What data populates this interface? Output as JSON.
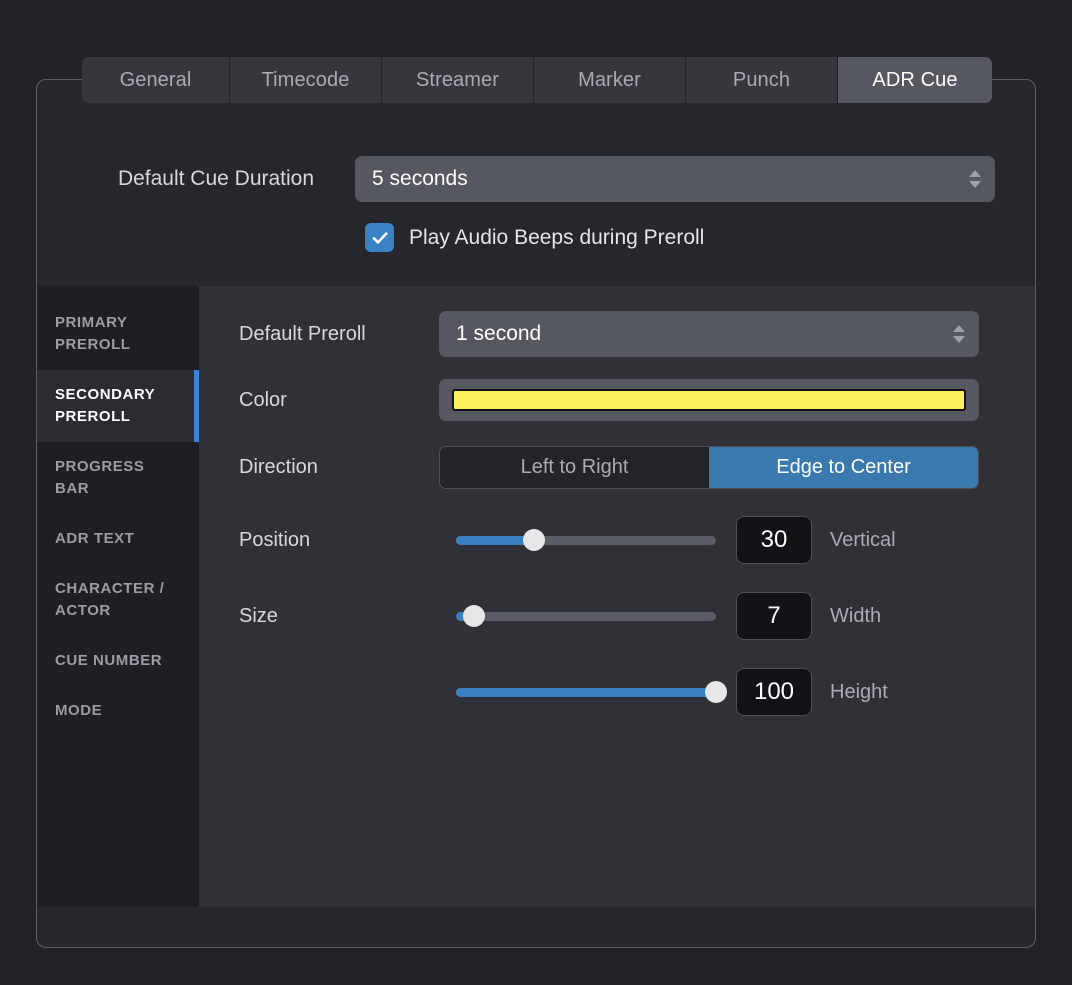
{
  "tabs": [
    {
      "label": "General",
      "width": 148,
      "active": false
    },
    {
      "label": "Timecode",
      "width": 152,
      "active": false
    },
    {
      "label": "Streamer",
      "width": 152,
      "active": false
    },
    {
      "label": "Marker",
      "width": 152,
      "active": false
    },
    {
      "label": "Punch",
      "width": 152,
      "active": false
    },
    {
      "label": "ADR Cue",
      "width": 154,
      "active": true
    }
  ],
  "top": {
    "duration_label": "Default Cue Duration",
    "duration_value": "5 seconds",
    "beeps_checkbox": {
      "label": "Play Audio Beeps during Preroll",
      "checked": true,
      "icon": "checkmark-icon"
    }
  },
  "sidebar": {
    "items": [
      {
        "label": "PRIMARY PREROLL",
        "active": false
      },
      {
        "label": "SECONDARY PREROLL",
        "active": true
      },
      {
        "label": "PROGRESS BAR",
        "active": false
      },
      {
        "label": "ADR TEXT",
        "active": false
      },
      {
        "label": "CHARACTER / ACTOR",
        "active": false
      },
      {
        "label": "CUE NUMBER",
        "active": false
      },
      {
        "label": "MODE",
        "active": false
      }
    ]
  },
  "content": {
    "preroll": {
      "label": "Default Preroll",
      "value": "1 second"
    },
    "color": {
      "label": "Color",
      "swatch_hex": "#ffef5e"
    },
    "direction": {
      "label": "Direction",
      "options": [
        {
          "label": "Left to Right",
          "active": false
        },
        {
          "label": "Edge to Center",
          "active": true
        }
      ]
    },
    "position": {
      "label": "Position",
      "value": "30",
      "percent": 30,
      "unit": "Vertical"
    },
    "size": {
      "label": "Size",
      "width": {
        "value": "7",
        "percent": 7,
        "unit": "Width"
      },
      "height": {
        "value": "100",
        "percent": 100,
        "unit": "Height"
      }
    }
  },
  "colors": {
    "accent_blue": "#3a7fc0",
    "active_tab_bg": "#55585e",
    "swatch_yellow": "#ffef5e",
    "sidebar_active_indicator": "#3b82d9"
  }
}
